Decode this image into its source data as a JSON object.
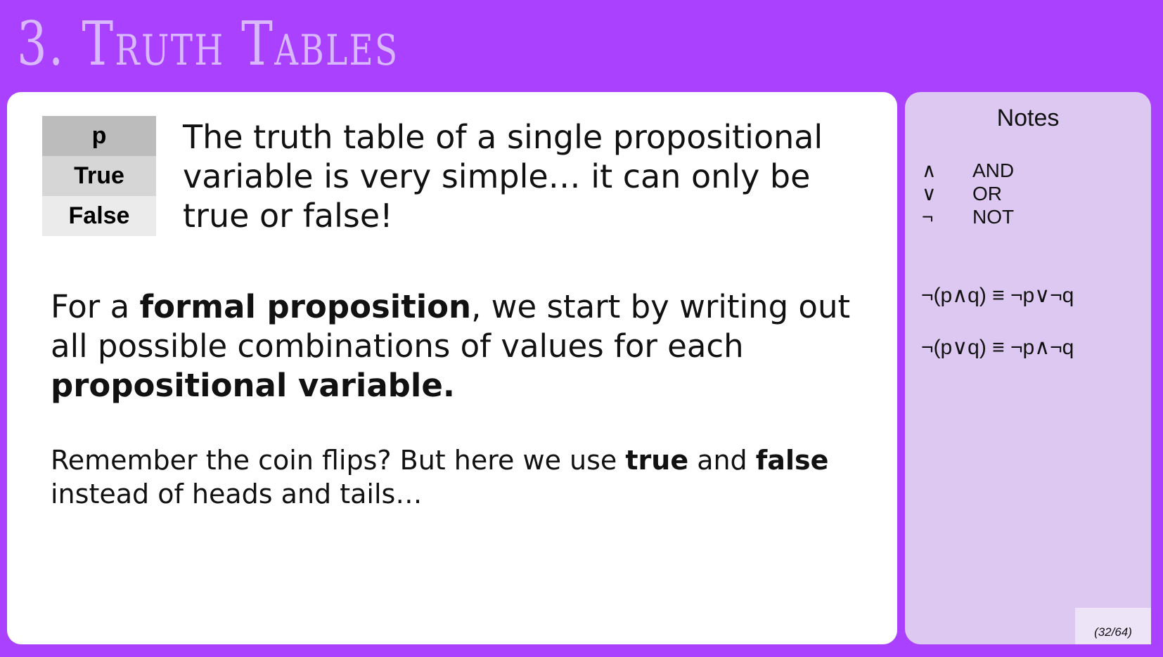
{
  "slide": {
    "title": "3. Truth Tables",
    "page_counter": "(32/64)"
  },
  "truth_table": {
    "header": "p",
    "rows": [
      "True",
      "False"
    ]
  },
  "intro": {
    "text": "The truth table of a single propositional variable is very simple… it can only be true or false!"
  },
  "formal": {
    "part1": "For a ",
    "bold1": "formal proposition",
    "part2": ", we start by writing out all possible combinations of values for each ",
    "bold2": "propositional variable."
  },
  "remember": {
    "part1": "Remember the coin flips? But here we use ",
    "bold1": "true",
    "part2": " and ",
    "bold2": "false",
    "part3": " instead of heads and tails…"
  },
  "notes": {
    "title": "Notes",
    "legend": [
      {
        "symbol": "∧",
        "meaning": "AND"
      },
      {
        "symbol": "∨",
        "meaning": "OR"
      },
      {
        "symbol": "¬",
        "meaning": "NOT"
      }
    ],
    "laws": [
      "¬(p∧q) ≡ ¬p∨¬q",
      "¬(p∨q) ≡ ¬p∧¬q"
    ]
  },
  "colors": {
    "background": "#a941ff",
    "title": "#d9b8ff",
    "notes_panel": "#ddc8f2",
    "main_card": "#ffffff"
  }
}
